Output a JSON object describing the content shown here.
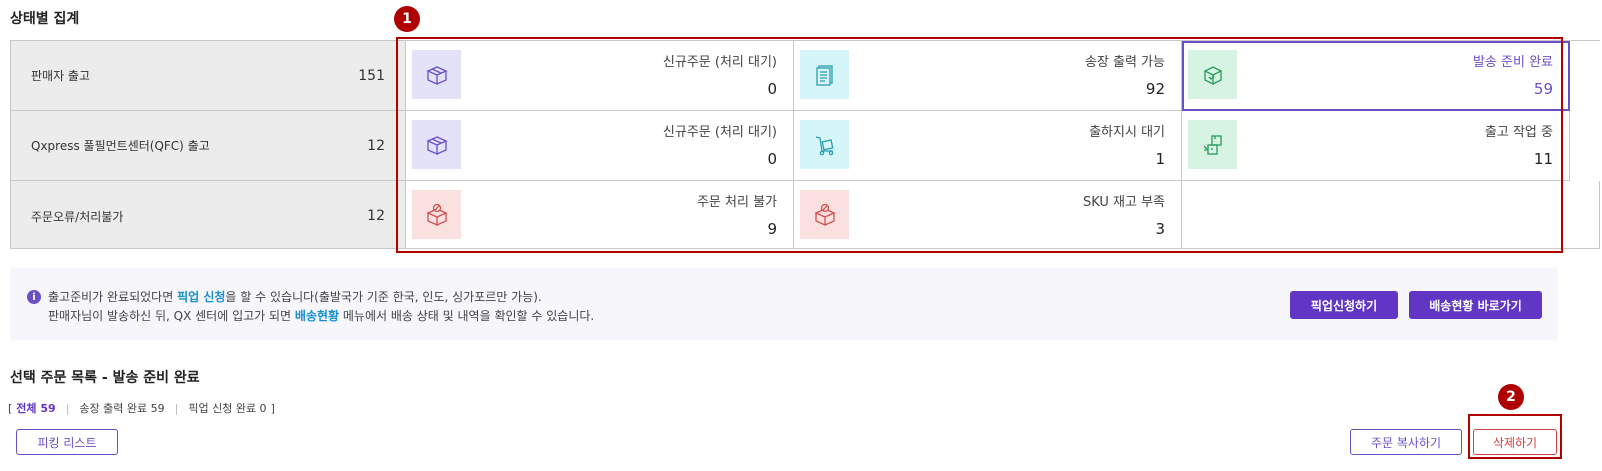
{
  "section_title": "상태별 집계",
  "left_rows": [
    {
      "label": "판매자 출고",
      "count": "151"
    },
    {
      "label": "Qxpress 풀필먼트센터(QFC) 출고",
      "count": "12"
    },
    {
      "label": "주문오류/처리불가",
      "count": "12"
    }
  ],
  "grid": {
    "r1c1": {
      "label": "신규주문 (처리 대기)",
      "value": "0",
      "icon": "box-icon"
    },
    "r1c2": {
      "label": "송장 출력 가능",
      "value": "92",
      "icon": "invoice-icon"
    },
    "r1c3": {
      "label": "발송 준비 완료",
      "value": "59",
      "icon": "package-ready-icon"
    },
    "r2c1": {
      "label": "신규주문 (처리 대기)",
      "value": "0",
      "icon": "box-icon"
    },
    "r2c2": {
      "label": "출하지시 대기",
      "value": "1",
      "icon": "hand-truck-icon"
    },
    "r2c3": {
      "label": "출고 작업 중",
      "value": "11",
      "icon": "boxes-icon"
    },
    "r3c1": {
      "label": "주문 처리 불가",
      "value": "9",
      "icon": "box-blocked-icon"
    },
    "r3c2": {
      "label": "SKU 재고 부족",
      "value": "3",
      "icon": "box-blocked-icon"
    }
  },
  "markers": [
    "1",
    "2"
  ],
  "info": {
    "line1_pre": "출고준비가 완료되었다면 ",
    "line1_link": "픽업 신청",
    "line1_post": "을 할 수 있습니다(출발국가 기준 한국, 인도, 싱가포르만 가능).",
    "line2_pre": "판매자님이 발송하신 뒤, QX 센터에 입고가 되면 ",
    "line2_link": "배송현황",
    "line2_post": " 메뉴에서 배송 상태 및 내역을 확인할 수 있습니다.",
    "btn_pickup": "픽업신청하기",
    "btn_shipping": "배송현황 바로가기"
  },
  "list": {
    "title": "선택 주문 목록 - 발송 준비 완료",
    "bracket_open": "[",
    "bracket_close": "]",
    "filter_all": "전체 59",
    "filter_invoice": "송장 출력 완료 59",
    "filter_pickup": "픽업 신청 완료 0",
    "btn_picking": "피킹 리스트",
    "btn_copy": "주문 복사하기",
    "btn_delete": "삭제하기"
  },
  "colors": {
    "accent": "#6236c4",
    "highlight": "#b00000",
    "link": "#1a8fd0"
  }
}
